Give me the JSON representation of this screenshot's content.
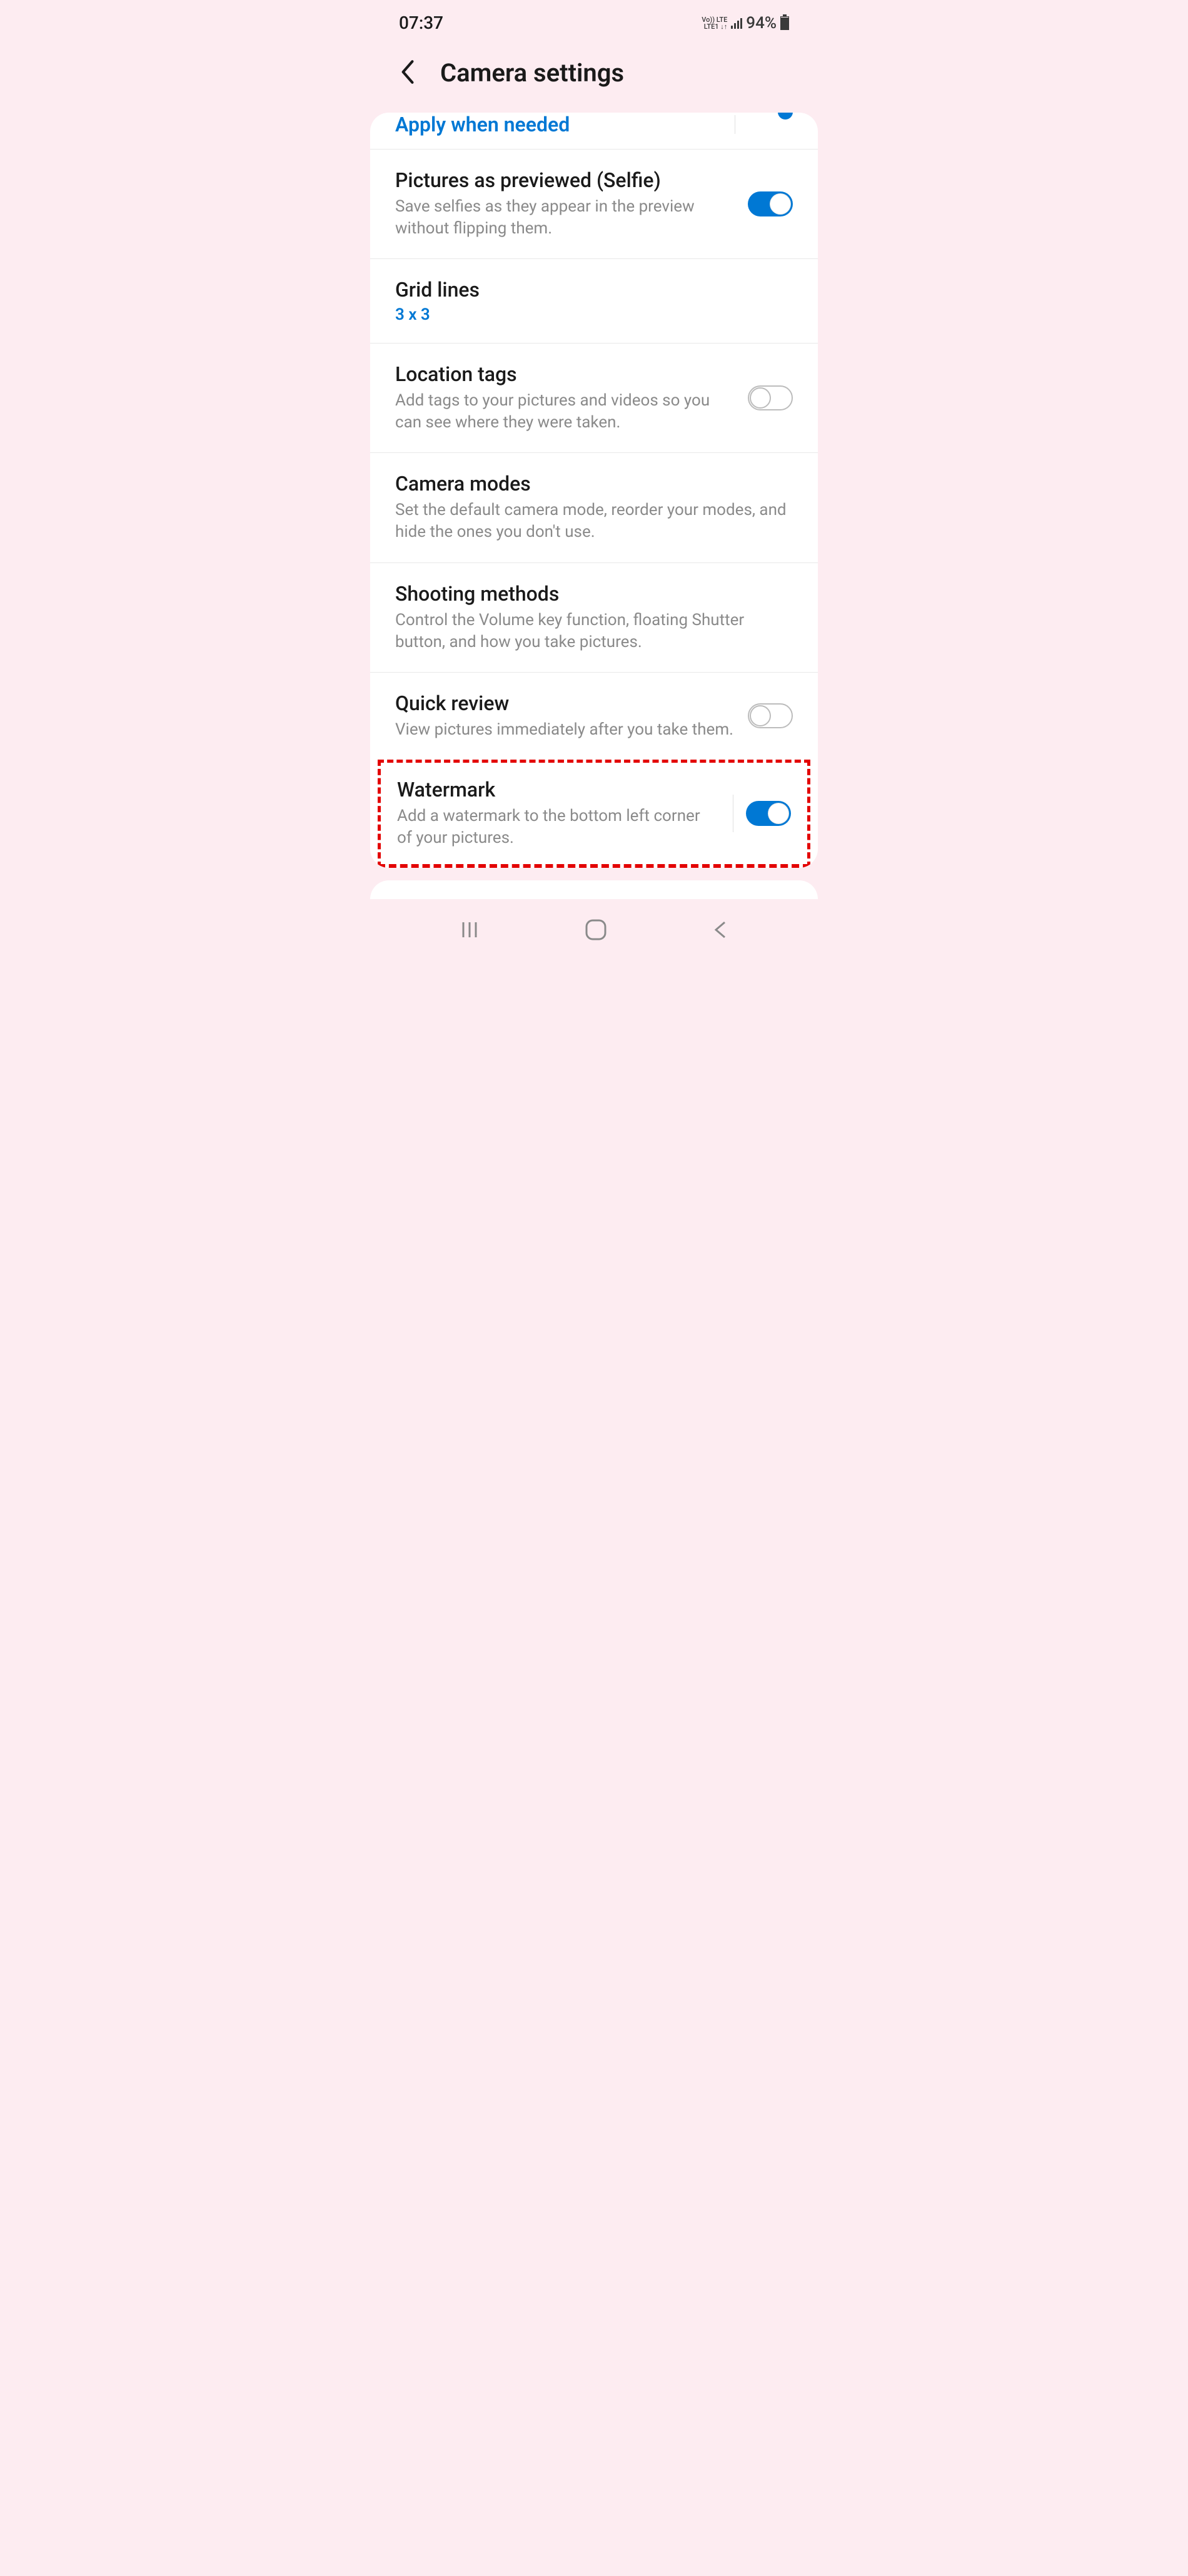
{
  "status": {
    "time": "07:37",
    "network_top": "Vo))  LTE",
    "network_bottom": "LTE1  ↓↑",
    "battery_percent": "94%"
  },
  "header": {
    "title": "Camera settings"
  },
  "settings": {
    "apply": {
      "title": "Apply when needed"
    },
    "selfie": {
      "title": "Pictures as previewed (Selfie)",
      "desc": "Save selfies as they appear in the preview without flipping them."
    },
    "gridlines": {
      "title": "Grid lines",
      "value": "3 x 3"
    },
    "location": {
      "title": "Location tags",
      "desc": "Add tags to your pictures and videos so you can see where they were taken."
    },
    "modes": {
      "title": "Camera modes",
      "desc": "Set the default camera mode, reorder your modes, and hide the ones you don't use."
    },
    "shooting": {
      "title": "Shooting methods",
      "desc": "Control the Volume key function, floating Shutter button, and how you take pictures."
    },
    "quickreview": {
      "title": "Quick review",
      "desc": "View pictures immediately after you take them."
    },
    "watermark": {
      "title": "Watermark",
      "desc": "Add a watermark to the bottom left corner of your pictures."
    }
  }
}
